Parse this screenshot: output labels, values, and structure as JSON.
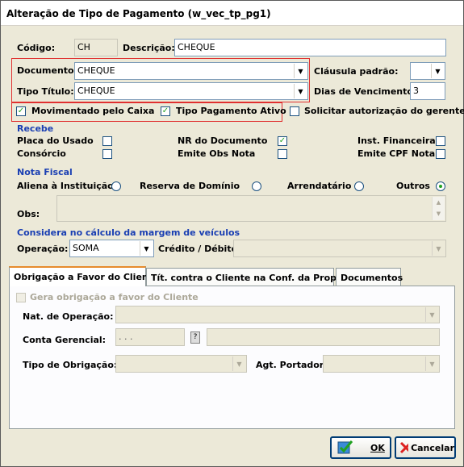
{
  "window": {
    "title": "Alteração de Tipo de Pagamento (w_vec_tp_pg1)"
  },
  "codigo": {
    "label": "Código:",
    "value": "CH"
  },
  "descricao": {
    "label": "Descrição:",
    "value": "CHEQUE"
  },
  "documento": {
    "label": "Documento:",
    "value": "CHEQUE"
  },
  "tipo_titulo": {
    "label": "Tipo Título:",
    "value": "CHEQUE"
  },
  "clausula_padrao": {
    "label": "Cláusula padrão:",
    "value": ""
  },
  "dias_vencimento": {
    "label": "Dias de Vencimento:",
    "value": "3"
  },
  "checks_top": {
    "movimentado": {
      "label": "Movimentado pelo Caixa",
      "checked": true
    },
    "tipo_pag_ativo": {
      "label": "Tipo Pagamento Ativo",
      "checked": true
    },
    "solicitar_aut": {
      "label": "Solicitar autorização do gerente",
      "checked": false
    }
  },
  "recebe": {
    "title": "Recebe",
    "placa_usado": "Placa do Usado",
    "consorcio": "Consórcio",
    "nr_documento": "NR do Documento",
    "emite_obs_nota": "Emite Obs Nota",
    "inst_financeira": "Inst. Financeira",
    "emite_cpf_nota": "Emite CPF Nota"
  },
  "nota_fiscal": {
    "title": "Nota Fiscal",
    "options": [
      "Aliena à Instituição",
      "Reserva de Domínio",
      "Arrendatário",
      "Outros"
    ],
    "selected": "Outros",
    "obs_label": "Obs:"
  },
  "margem": {
    "title": "Considera no cálculo da margem de veículos",
    "operacao_label": "Operação:",
    "operacao_value": "SOMA",
    "credito_label": "Crédito / Débito:",
    "credito_value": ""
  },
  "tabs": [
    {
      "label": "Obrigação a Favor do Cliente",
      "active": true
    },
    {
      "label": "Tít. contra o Cliente na Conf. da Proposta",
      "active": false
    },
    {
      "label": "Documentos",
      "active": false
    }
  ],
  "tab_obrigacao": {
    "gera_label": "Gera obrigação a favor do Cliente",
    "nat_operacao_label": "Nat. de Operação:",
    "conta_gerencial_label": "Conta Gerencial:",
    "conta_gerencial_mask": ". . .",
    "tipo_obrigacao_label": "Tipo de Obrigação:",
    "agt_portador_label": "Agt. Portador:"
  },
  "buttons": {
    "ok": "OK",
    "cancel": "Cancelar"
  },
  "colors": {
    "section_title": "#1a3fb3",
    "highlight_box": "#e03030",
    "check_mark": "#21a121"
  }
}
